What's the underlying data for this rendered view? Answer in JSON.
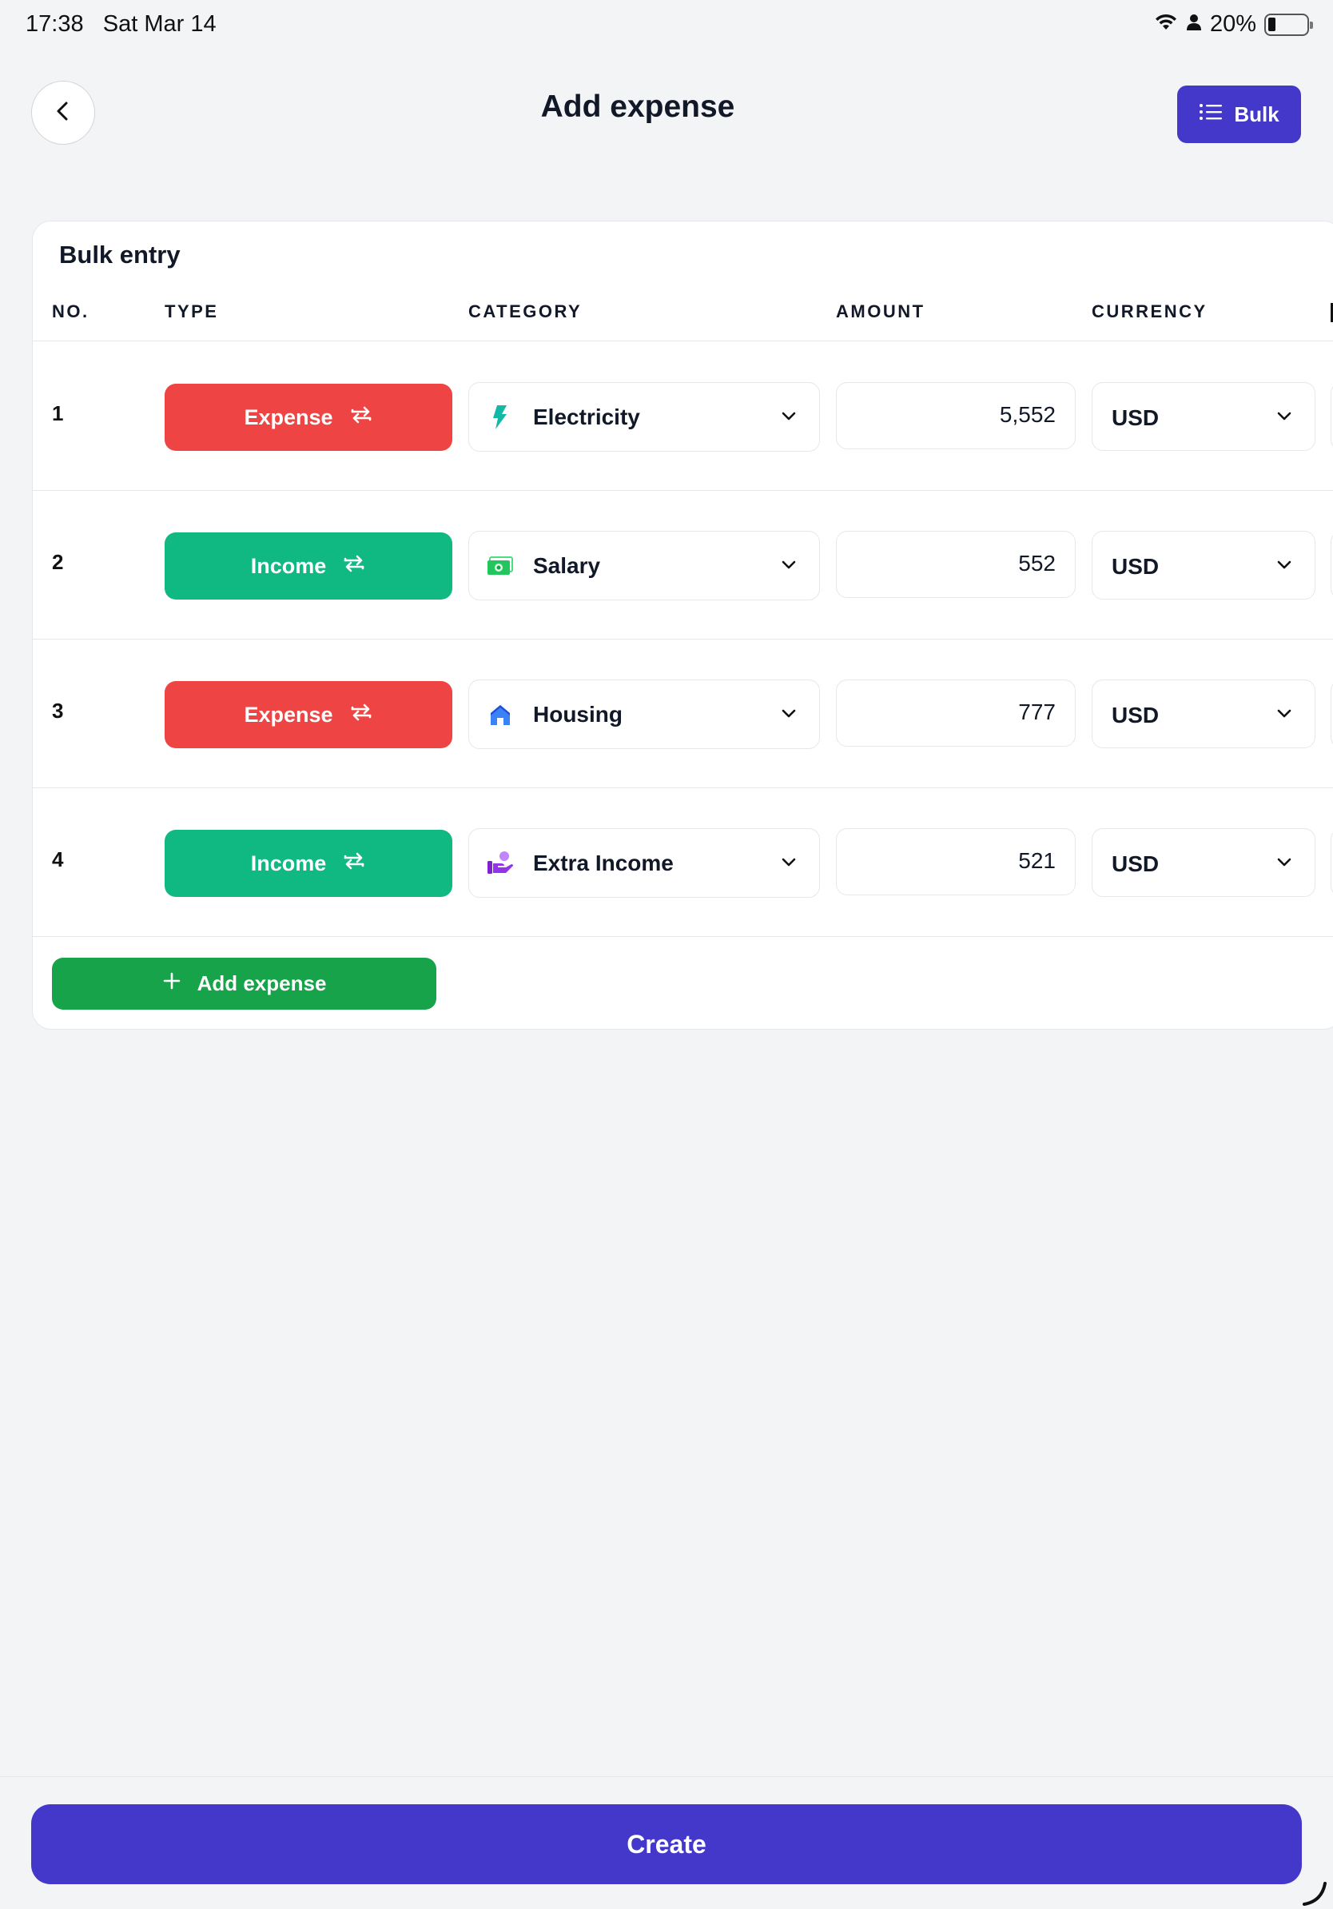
{
  "status_bar": {
    "time": "17:38",
    "date": "Sat Mar 14",
    "battery": "20%",
    "battery_level": 0.2
  },
  "header": {
    "title": "Add expense",
    "back_icon": "chevron-left-icon",
    "bulk_label": "Bulk",
    "bulk_icon": "list-icon"
  },
  "bulk": {
    "title": "Bulk entry",
    "columns": {
      "no": "NO.",
      "type": "TYPE",
      "category": "CATEGORY",
      "amount": "AMOUNT",
      "currency": "CURRENCY"
    },
    "rows": [
      {
        "no": "1",
        "type": "Expense",
        "type_color": "#ef4444",
        "category": "Electricity",
        "category_icon": "lightning-icon",
        "amount": "5,552",
        "currency": "USD"
      },
      {
        "no": "2",
        "type": "Income",
        "type_color": "#10b981",
        "category": "Salary",
        "category_icon": "money-icon",
        "amount": "552",
        "currency": "USD"
      },
      {
        "no": "3",
        "type": "Expense",
        "type_color": "#ef4444",
        "category": "Housing",
        "category_icon": "house-icon",
        "amount": "777",
        "currency": "USD"
      },
      {
        "no": "4",
        "type": "Income",
        "type_color": "#10b981",
        "category": "Extra Income",
        "category_icon": "extra-income-icon",
        "amount": "521",
        "currency": "USD"
      }
    ],
    "add_label": "Add expense"
  },
  "footer": {
    "create_label": "Create"
  },
  "colors": {
    "primary": "#4338ca",
    "expense": "#ef4444",
    "income": "#10b981",
    "add": "#16a34a",
    "background": "#f3f4f6"
  }
}
